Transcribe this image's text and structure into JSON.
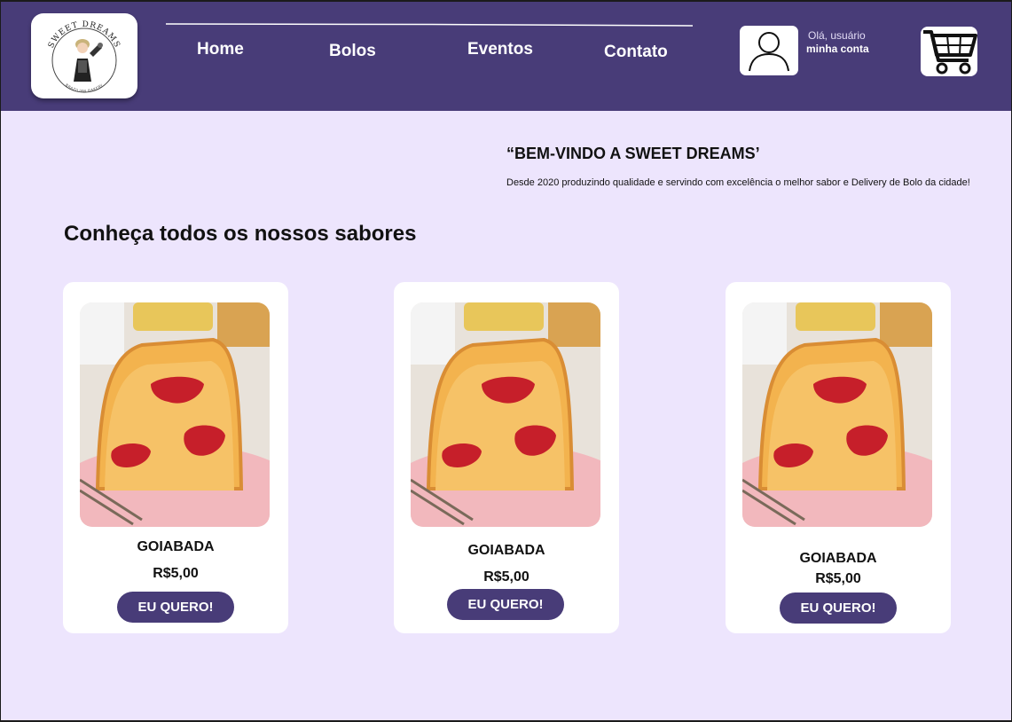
{
  "header": {
    "logo": {
      "text_top": "SWEET DREAMS",
      "text_bottom": "BRAZILIAN BAKERY"
    },
    "nav": [
      {
        "label": "Home"
      },
      {
        "label": "Bolos"
      },
      {
        "label": "Eventos"
      },
      {
        "label": "Contato"
      }
    ],
    "user": {
      "greeting": "Olá, usuário",
      "account_label": "minha conta",
      "icon": "user-icon"
    },
    "cart": {
      "icon": "cart-icon"
    }
  },
  "welcome": {
    "title": "“BEM-VINDO A SWEET DREAMS’",
    "text": "Desde 2020 produzindo qualidade e servindo com excelência o melhor sabor e Delivery de Bolo da cidade!"
  },
  "section_title": "Conheça todos os nossos sabores",
  "products": [
    {
      "name": "GOIABADA",
      "price": "R$5,00",
      "button": "EU QUERO!"
    },
    {
      "name": "GOIABADA",
      "price": "R$5,00",
      "button": "EU QUERO!"
    },
    {
      "name": "GOIABADA",
      "price": "R$5,00",
      "button": "EU QUERO!"
    }
  ],
  "colors": {
    "header_bg": "#483c78",
    "page_bg": "#ede5fd",
    "button_bg": "#483c78",
    "card_bg": "#ffffff"
  }
}
